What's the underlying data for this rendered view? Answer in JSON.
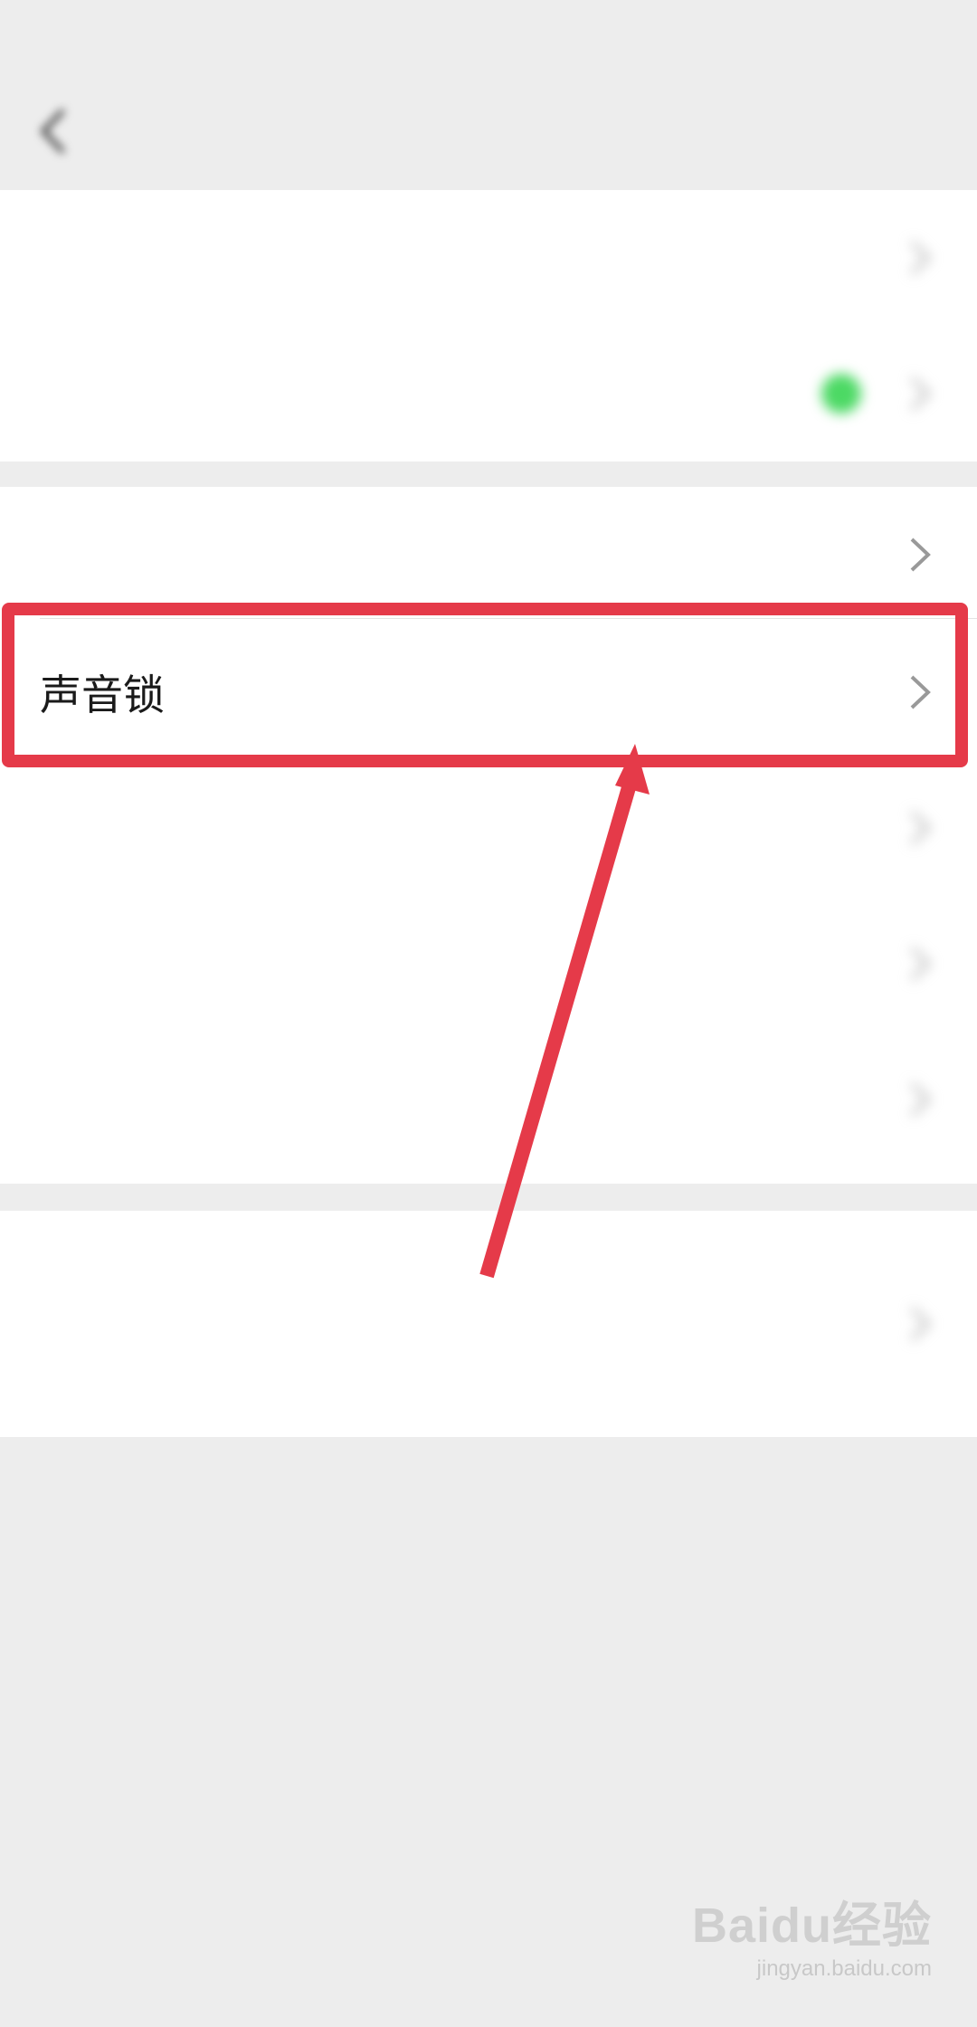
{
  "status_bar": {
    "left_text": "",
    "right_text": ""
  },
  "nav": {
    "title": ""
  },
  "settings": {
    "group1": [
      {
        "label": "",
        "value": ""
      },
      {
        "label": "",
        "value": ""
      }
    ],
    "group2": [
      {
        "label": ""
      },
      {
        "label": "声音锁"
      },
      {
        "label": ""
      },
      {
        "label": ""
      },
      {
        "label": ""
      }
    ],
    "group3": {
      "label": "",
      "description": ""
    }
  },
  "annotation": {
    "highlight_color": "#e53a49",
    "highlighted_item": "声音锁"
  },
  "watermark": {
    "brand": "Baidu经验",
    "site": "jingyan.baidu.com"
  },
  "colors": {
    "background": "#ededed",
    "row_background": "#ffffff",
    "accent_green": "#4cd964",
    "annotation_red": "#e53a49"
  }
}
